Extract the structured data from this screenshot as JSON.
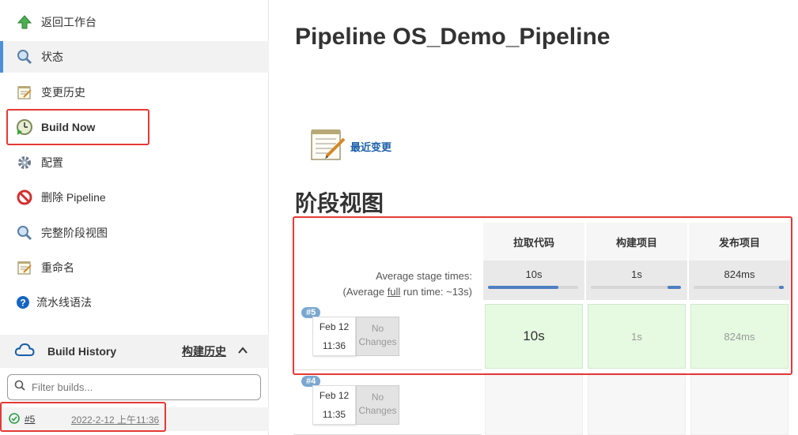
{
  "sidebar": {
    "items": [
      {
        "label": "返回工作台",
        "icon": "up-arrow-icon"
      },
      {
        "label": "状态",
        "icon": "magnifier-icon"
      },
      {
        "label": "变更历史",
        "icon": "notepad-icon"
      },
      {
        "label": "Build Now",
        "icon": "clock-play-icon"
      },
      {
        "label": "配置",
        "icon": "gear-icon"
      },
      {
        "label": "删除 Pipeline",
        "icon": "no-entry-icon"
      },
      {
        "label": "完整阶段视图",
        "icon": "magnifier-icon"
      },
      {
        "label": "重命名",
        "icon": "notepad-icon"
      },
      {
        "label": "流水线语法",
        "icon": "help-icon"
      }
    ]
  },
  "build_history": {
    "title": "Build History",
    "link": "构建历史",
    "filter_placeholder": "Filter builds...",
    "builds": [
      {
        "number": "#5",
        "date": "2022-2-12 上午11:36",
        "status": "success"
      }
    ]
  },
  "main": {
    "title": "Pipeline OS_Demo_Pipeline",
    "recent_changes": "最近变更",
    "stage_view_title": "阶段视图"
  },
  "stage_view": {
    "stages": [
      "拉取代码",
      "构建项目",
      "发布项目"
    ],
    "average_label_line1": "Average stage times:",
    "average_label_prefix": "(Average ",
    "average_label_full": "full",
    "average_label_suffix": " run time: ~13s)",
    "average_times": [
      "10s",
      "1s",
      "824ms"
    ],
    "average_bar_fraction": [
      0.78,
      0.15,
      0.05
    ],
    "runs": [
      {
        "badge": "#5",
        "month_day": "Feb 12",
        "time": "11:36",
        "no_changes_1": "No",
        "no_changes_2": "Changes",
        "durations": [
          "10s",
          "1s",
          "824ms"
        ]
      },
      {
        "badge": "#4",
        "month_day": "Feb 12",
        "time": "11:35",
        "no_changes_1": "No",
        "no_changes_2": "Changes",
        "durations": []
      }
    ]
  },
  "colors": {
    "accent": "#4a90d9",
    "highlight_box": "#e53935",
    "success_cell": "#e5fae1",
    "link": "#1a5ea8"
  }
}
